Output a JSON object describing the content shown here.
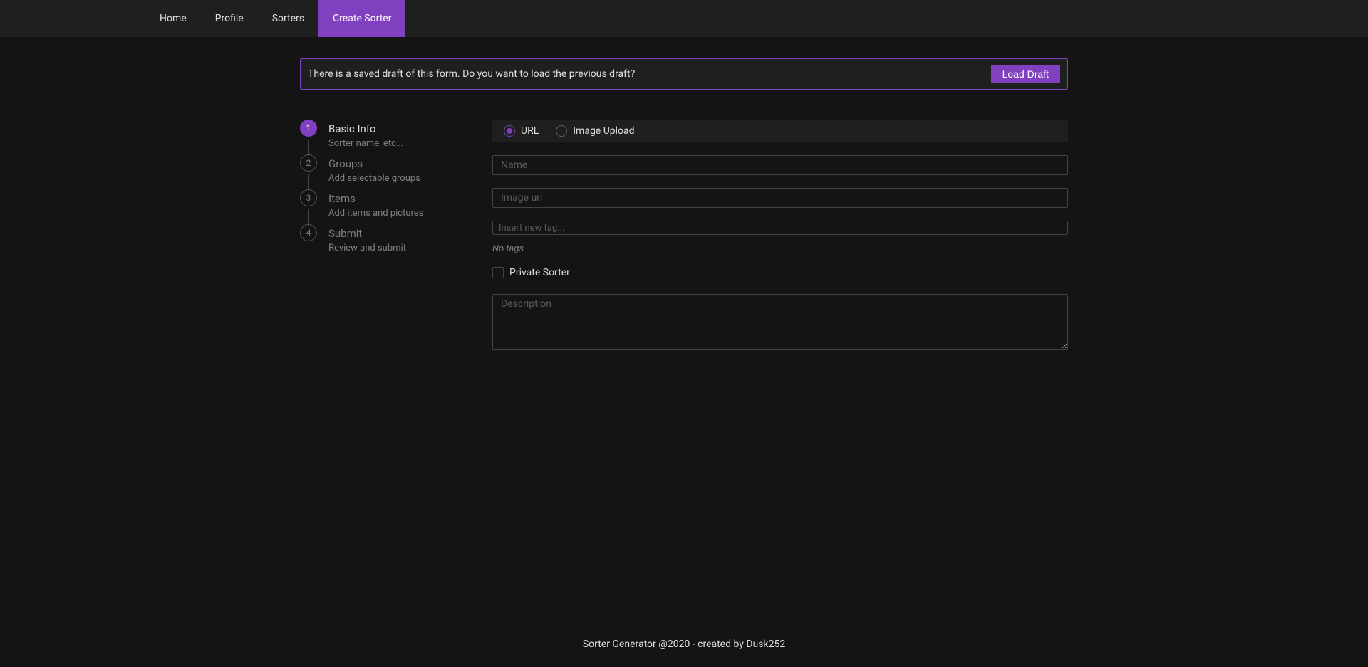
{
  "nav": {
    "items": [
      {
        "label": "Home",
        "active": false
      },
      {
        "label": "Profile",
        "active": false
      },
      {
        "label": "Sorters",
        "active": false
      },
      {
        "label": "Create Sorter",
        "active": true
      }
    ]
  },
  "alert": {
    "message": "There is a saved draft of this form. Do you want to load the previous draft?",
    "button_label": "Load Draft"
  },
  "steps": [
    {
      "num": "1",
      "title": "Basic Info",
      "description": "Sorter name, etc...",
      "active": true
    },
    {
      "num": "2",
      "title": "Groups",
      "description": "Add selectable groups",
      "active": false
    },
    {
      "num": "3",
      "title": "Items",
      "description": "Add items and pictures",
      "active": false
    },
    {
      "num": "4",
      "title": "Submit",
      "description": "Review and submit",
      "active": false
    }
  ],
  "form": {
    "image_source": {
      "options": [
        {
          "label": "URL",
          "selected": true
        },
        {
          "label": "Image Upload",
          "selected": false
        }
      ]
    },
    "name_placeholder": "Name",
    "image_url_placeholder": "Image url",
    "tag_placeholder": "Insert new tag...",
    "no_tags_text": "No tags",
    "private_label": "Private Sorter",
    "description_placeholder": "Description"
  },
  "footer": {
    "text": "Sorter Generator @2020 - created by Dusk252"
  }
}
